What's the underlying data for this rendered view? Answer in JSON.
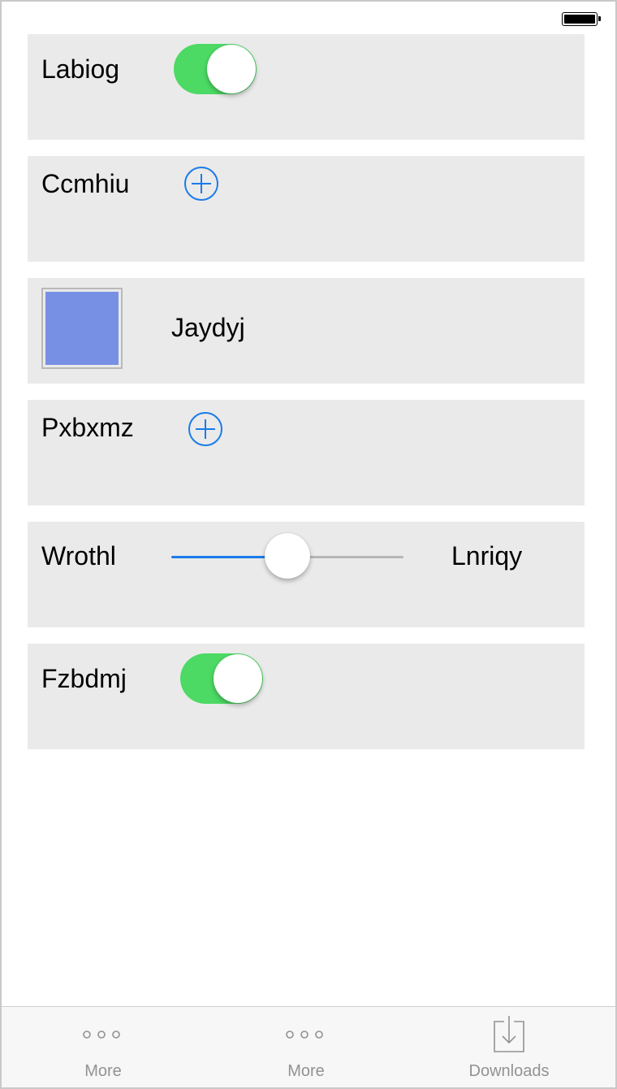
{
  "colors": {
    "row_bg": "#eaeaea",
    "toggle_on": "#4cd964",
    "accent_blue": "#1b7bea",
    "swatch": "#7890e4",
    "slider_track_off": "#b7b7b7",
    "tab_gray": "#929292"
  },
  "rows": [
    {
      "type": "toggle",
      "label": "Labiog",
      "on": true
    },
    {
      "type": "add",
      "label": "Ccmhiu",
      "icon": "plus-circle-icon"
    },
    {
      "type": "color",
      "label": "Jaydyj",
      "color": "#7890e4"
    },
    {
      "type": "add",
      "label": "Pxbxmz",
      "icon": "plus-circle-icon"
    },
    {
      "type": "slider",
      "label": "Wrothl",
      "value_label": "Lnriqy",
      "value_fraction": 0.5
    },
    {
      "type": "toggle",
      "label": "Fzbdmj",
      "on": true
    }
  ],
  "tabbar": {
    "items": [
      {
        "label": "More",
        "icon": "more-icon"
      },
      {
        "label": "More",
        "icon": "more-icon"
      },
      {
        "label": "Downloads",
        "icon": "downloads-icon"
      }
    ]
  }
}
